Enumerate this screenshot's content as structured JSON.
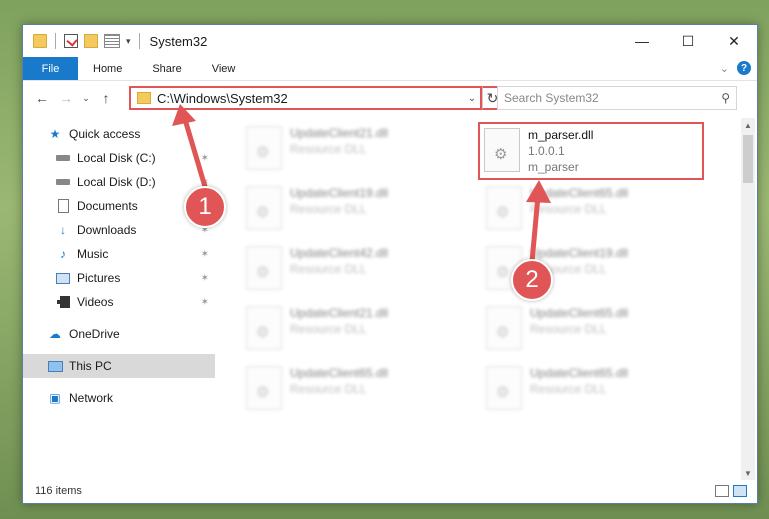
{
  "window": {
    "title": "System32"
  },
  "ribbon": {
    "tabs": [
      "File",
      "Home",
      "Share",
      "View"
    ]
  },
  "address": {
    "path": "C:\\Windows\\System32"
  },
  "search": {
    "placeholder": "Search System32"
  },
  "nav": {
    "items": [
      {
        "label": "Quick access",
        "icon": "star-icon",
        "pinned": false
      },
      {
        "label": "Local Disk (C:)",
        "icon": "drive-icon",
        "pinned": true
      },
      {
        "label": "Local Disk (D:)",
        "icon": "drive-icon",
        "pinned": true
      },
      {
        "label": "Documents",
        "icon": "documents-icon",
        "pinned": true
      },
      {
        "label": "Downloads",
        "icon": "download-icon",
        "pinned": true
      },
      {
        "label": "Music",
        "icon": "music-icon",
        "pinned": true
      },
      {
        "label": "Pictures",
        "icon": "pictures-icon",
        "pinned": true
      },
      {
        "label": "Videos",
        "icon": "videos-icon",
        "pinned": true
      },
      {
        "label": "OneDrive",
        "icon": "cloud-icon",
        "pinned": false
      },
      {
        "label": "This PC",
        "icon": "pc-icon",
        "pinned": false,
        "selected": true
      },
      {
        "label": "Network",
        "icon": "network-icon",
        "pinned": false
      }
    ]
  },
  "files": [
    {
      "name": "UpdateClient21.dll",
      "sub": "Resource DLL"
    },
    {
      "name": "m_parser.dll",
      "sub": "1.0.0.1",
      "sub2": "m_parser",
      "highlighted": true
    },
    {
      "name": "UpdateClient19.dll",
      "sub": "Resource DLL"
    },
    {
      "name": "UpdateClient65.dll",
      "sub": "Resource DLL"
    },
    {
      "name": "UpdateClient42.dll",
      "sub": "Resource DLL"
    },
    {
      "name": "UpdateClient19.dll",
      "sub": "Resource DLL"
    },
    {
      "name": "UpdateClient21.dll",
      "sub": "Resource DLL"
    },
    {
      "name": "UpdateClient65.dll",
      "sub": "Resource DLL"
    },
    {
      "name": "UpdateClient65.dll",
      "sub": "Resource DLL"
    },
    {
      "name": "UpdateClient65.dll",
      "sub": "Resource DLL"
    }
  ],
  "status": {
    "count": "116 items"
  },
  "callouts": {
    "step1": "1",
    "step2": "2",
    "color": "#e05555"
  }
}
